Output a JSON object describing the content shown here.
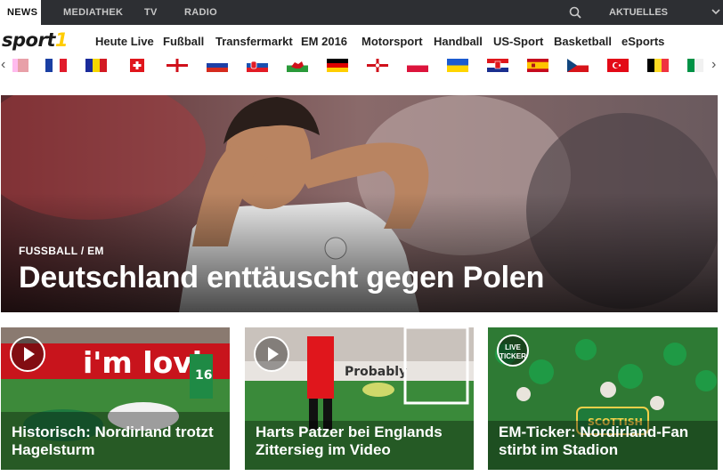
{
  "topbar": {
    "tabs": [
      "NEWS",
      "MEDIATHEK",
      "TV",
      "RADIO"
    ],
    "program_label": "AKTUELLES PROGRAMM"
  },
  "logo": {
    "text": "sport",
    "accent": "1"
  },
  "nav": [
    "Heute Live",
    "Fußball",
    "Transfermarkt",
    "EM 2016",
    "Motorsport",
    "Handball",
    "US-Sport",
    "Basketball",
    "eSports"
  ],
  "flags": [
    "partial",
    "france",
    "romania",
    "switzerland",
    "england",
    "russia",
    "slovakia",
    "wales",
    "germany",
    "northern-ireland",
    "poland",
    "ukraine",
    "croatia",
    "spain",
    "czech-republic",
    "turkey",
    "belgium",
    "italy"
  ],
  "hero": {
    "kicker": "FUSSBALL / EM",
    "headline": "Deutschland enttäuscht gegen Polen"
  },
  "cards": [
    {
      "badge": "play-icon",
      "title": "Historisch: Nordirland trotzt Hagelsturm",
      "ad_text": "i'm lovi",
      "shirt_number": "16"
    },
    {
      "badge": "play-icon",
      "title": "Harts Patzer bei Englands Zittersieg im Video",
      "ad_text": "Probably"
    },
    {
      "badge_text": "LIVE TICKER",
      "title": "EM-Ticker: Nordirland-Fan stirbt im Stadion",
      "scarf_text": "SCOTTISH"
    }
  ],
  "colors": {
    "topbar": "#2d2f33",
    "accent": "#ffcc00"
  }
}
